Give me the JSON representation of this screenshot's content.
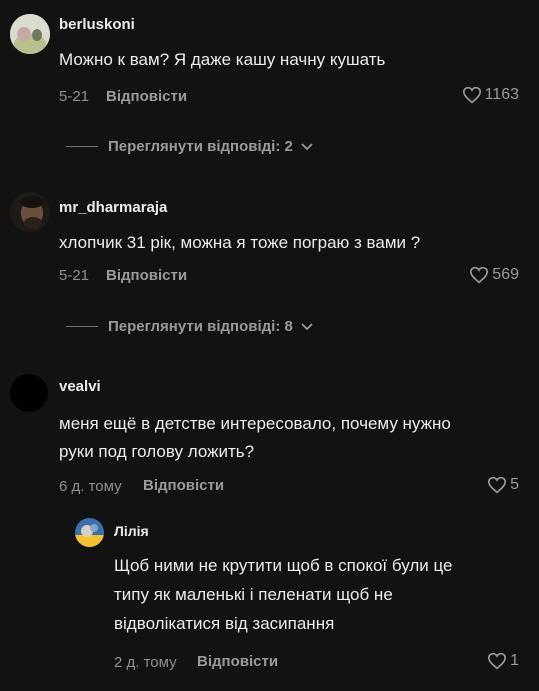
{
  "comments": [
    {
      "username": "berluskoni",
      "text": "Можно к вам? Я даже кашу начну кушать",
      "date": "5-21",
      "reply_label": "Відповісти",
      "likes": "1163",
      "view_replies": "Переглянути відповіді: 2"
    },
    {
      "username": "mr_dharmaraja",
      "text": "хлопчик 31 рік, можна я тоже пограю з вами ?",
      "date": "5-21",
      "reply_label": "Відповісти",
      "likes": "569",
      "view_replies": "Переглянути відповіді: 8"
    },
    {
      "username": "vealvi",
      "text_line1": "меня ещё в детстве интересовало, почему нужно",
      "text_line2": "руки под голову ложить?",
      "date": "6 д. тому",
      "reply_label": "Відповісти",
      "likes": "5"
    }
  ],
  "reply": {
    "username": "Лілія",
    "text_line1": "Щоб ними не крутити щоб в спокої були це",
    "text_line2": "типу як маленькі і пеленати щоб не",
    "text_line3": "відволікатися від засипання",
    "date": "2 д. тому",
    "reply_label": "Відповісти",
    "likes": "1"
  },
  "colors": {
    "background": "#121212",
    "text": "#ececec",
    "muted": "#8f8f8f"
  },
  "icons": [
    "heart-icon",
    "chevron-down-icon"
  ]
}
